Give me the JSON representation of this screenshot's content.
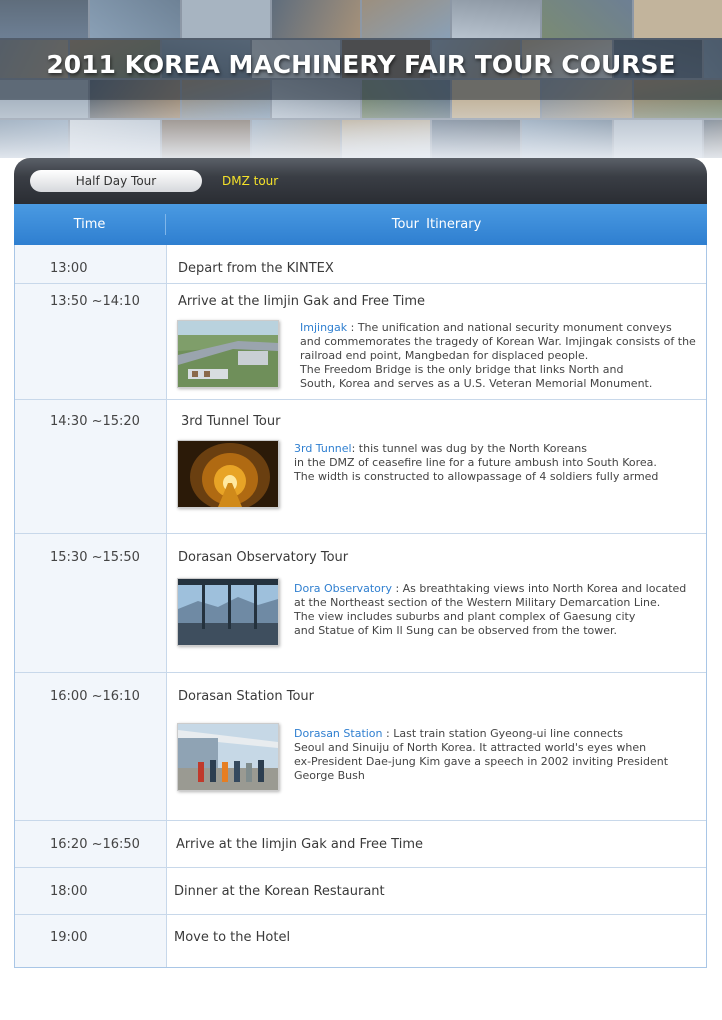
{
  "banner": {
    "title": "2011 KOREA MACHINERY FAIR TOUR COURSE"
  },
  "tabs": {
    "half_day": "Half Day Tour",
    "dmz": "DMZ tour"
  },
  "table": {
    "col_time": "Time",
    "col_itinerary": "Tour  Itinerary",
    "rows": [
      {
        "time": "13:00",
        "title": "Depart from the KINTEX"
      },
      {
        "time": "13:50 ~14:10",
        "title": "Arrive at the Iimjin Gak and Free Time",
        "keyword": "Imjingak",
        "lines": [
          " : The unification and national security monument conveys",
          "and commemorates the tragedy of Korean War. Imjingak consists of the",
          "railroad end point, Mangbedan for  displaced people.",
          "The  Freedom Bridge is the only bridge that links  North and",
          "South, Korea and serves as a  U.S.  Veteran  Memorial  Monument."
        ]
      },
      {
        "time": "14:30 ~15:20",
        "title": "3rd Tunnel Tour",
        "keyword": "3rd Tunnel",
        "lines": [
          ": this tunnel was dug by the North Koreans",
          "in the DMZ of ceasefire line for a future  ambush into South Korea.",
          "The width is constructed to allowpassage of 4 soldiers fully armed"
        ]
      },
      {
        "time": "15:30 ~15:50",
        "title": "Dorasan Observatory Tour",
        "keyword": "Dora Observatory",
        "lines": [
          " : As breathtaking views into North Korea and located",
          " at the Northeast section  of the Western Military Demarcation Line.",
          "The view includes  suburbs and plant complex of Gaesung city",
          "and Statue of Kim Il Sung can be observed from the tower."
        ]
      },
      {
        "time": "16:00 ~16:10",
        "title": "Dorasan Station Tour",
        "keyword": "Dorasan Station",
        "lines": [
          " : Last train station  Gyeong-ui line connects",
          "Seoul and Sinuiju of North Korea. It attracted world's eyes when",
          "ex-President Dae-jung Kim gave a speech in 2002 inviting President",
          "George Bush"
        ]
      },
      {
        "time": "16:20 ~16:50",
        "title": "Arrive at the Iimjin Gak and Free Time"
      },
      {
        "time": "18:00",
        "title": "Dinner at the Korean Restaurant"
      },
      {
        "time": "19:00",
        "title": "Move to the Hotel"
      }
    ]
  }
}
